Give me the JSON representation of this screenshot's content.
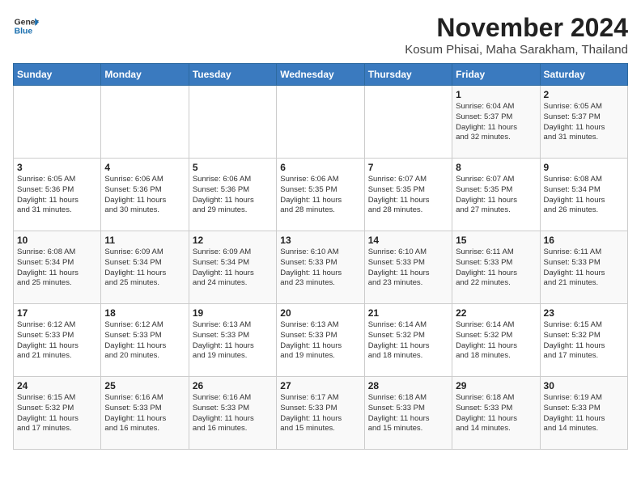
{
  "header": {
    "logo_line1": "General",
    "logo_line2": "Blue",
    "month_title": "November 2024",
    "location": "Kosum Phisai, Maha Sarakham, Thailand"
  },
  "weekdays": [
    "Sunday",
    "Monday",
    "Tuesday",
    "Wednesday",
    "Thursday",
    "Friday",
    "Saturday"
  ],
  "weeks": [
    [
      {
        "day": "",
        "info": ""
      },
      {
        "day": "",
        "info": ""
      },
      {
        "day": "",
        "info": ""
      },
      {
        "day": "",
        "info": ""
      },
      {
        "day": "",
        "info": ""
      },
      {
        "day": "1",
        "info": "Sunrise: 6:04 AM\nSunset: 5:37 PM\nDaylight: 11 hours\nand 32 minutes."
      },
      {
        "day": "2",
        "info": "Sunrise: 6:05 AM\nSunset: 5:37 PM\nDaylight: 11 hours\nand 31 minutes."
      }
    ],
    [
      {
        "day": "3",
        "info": "Sunrise: 6:05 AM\nSunset: 5:36 PM\nDaylight: 11 hours\nand 31 minutes."
      },
      {
        "day": "4",
        "info": "Sunrise: 6:06 AM\nSunset: 5:36 PM\nDaylight: 11 hours\nand 30 minutes."
      },
      {
        "day": "5",
        "info": "Sunrise: 6:06 AM\nSunset: 5:36 PM\nDaylight: 11 hours\nand 29 minutes."
      },
      {
        "day": "6",
        "info": "Sunrise: 6:06 AM\nSunset: 5:35 PM\nDaylight: 11 hours\nand 28 minutes."
      },
      {
        "day": "7",
        "info": "Sunrise: 6:07 AM\nSunset: 5:35 PM\nDaylight: 11 hours\nand 28 minutes."
      },
      {
        "day": "8",
        "info": "Sunrise: 6:07 AM\nSunset: 5:35 PM\nDaylight: 11 hours\nand 27 minutes."
      },
      {
        "day": "9",
        "info": "Sunrise: 6:08 AM\nSunset: 5:34 PM\nDaylight: 11 hours\nand 26 minutes."
      }
    ],
    [
      {
        "day": "10",
        "info": "Sunrise: 6:08 AM\nSunset: 5:34 PM\nDaylight: 11 hours\nand 25 minutes."
      },
      {
        "day": "11",
        "info": "Sunrise: 6:09 AM\nSunset: 5:34 PM\nDaylight: 11 hours\nand 25 minutes."
      },
      {
        "day": "12",
        "info": "Sunrise: 6:09 AM\nSunset: 5:34 PM\nDaylight: 11 hours\nand 24 minutes."
      },
      {
        "day": "13",
        "info": "Sunrise: 6:10 AM\nSunset: 5:33 PM\nDaylight: 11 hours\nand 23 minutes."
      },
      {
        "day": "14",
        "info": "Sunrise: 6:10 AM\nSunset: 5:33 PM\nDaylight: 11 hours\nand 23 minutes."
      },
      {
        "day": "15",
        "info": "Sunrise: 6:11 AM\nSunset: 5:33 PM\nDaylight: 11 hours\nand 22 minutes."
      },
      {
        "day": "16",
        "info": "Sunrise: 6:11 AM\nSunset: 5:33 PM\nDaylight: 11 hours\nand 21 minutes."
      }
    ],
    [
      {
        "day": "17",
        "info": "Sunrise: 6:12 AM\nSunset: 5:33 PM\nDaylight: 11 hours\nand 21 minutes."
      },
      {
        "day": "18",
        "info": "Sunrise: 6:12 AM\nSunset: 5:33 PM\nDaylight: 11 hours\nand 20 minutes."
      },
      {
        "day": "19",
        "info": "Sunrise: 6:13 AM\nSunset: 5:33 PM\nDaylight: 11 hours\nand 19 minutes."
      },
      {
        "day": "20",
        "info": "Sunrise: 6:13 AM\nSunset: 5:33 PM\nDaylight: 11 hours\nand 19 minutes."
      },
      {
        "day": "21",
        "info": "Sunrise: 6:14 AM\nSunset: 5:32 PM\nDaylight: 11 hours\nand 18 minutes."
      },
      {
        "day": "22",
        "info": "Sunrise: 6:14 AM\nSunset: 5:32 PM\nDaylight: 11 hours\nand 18 minutes."
      },
      {
        "day": "23",
        "info": "Sunrise: 6:15 AM\nSunset: 5:32 PM\nDaylight: 11 hours\nand 17 minutes."
      }
    ],
    [
      {
        "day": "24",
        "info": "Sunrise: 6:15 AM\nSunset: 5:32 PM\nDaylight: 11 hours\nand 17 minutes."
      },
      {
        "day": "25",
        "info": "Sunrise: 6:16 AM\nSunset: 5:33 PM\nDaylight: 11 hours\nand 16 minutes."
      },
      {
        "day": "26",
        "info": "Sunrise: 6:16 AM\nSunset: 5:33 PM\nDaylight: 11 hours\nand 16 minutes."
      },
      {
        "day": "27",
        "info": "Sunrise: 6:17 AM\nSunset: 5:33 PM\nDaylight: 11 hours\nand 15 minutes."
      },
      {
        "day": "28",
        "info": "Sunrise: 6:18 AM\nSunset: 5:33 PM\nDaylight: 11 hours\nand 15 minutes."
      },
      {
        "day": "29",
        "info": "Sunrise: 6:18 AM\nSunset: 5:33 PM\nDaylight: 11 hours\nand 14 minutes."
      },
      {
        "day": "30",
        "info": "Sunrise: 6:19 AM\nSunset: 5:33 PM\nDaylight: 11 hours\nand 14 minutes."
      }
    ]
  ]
}
